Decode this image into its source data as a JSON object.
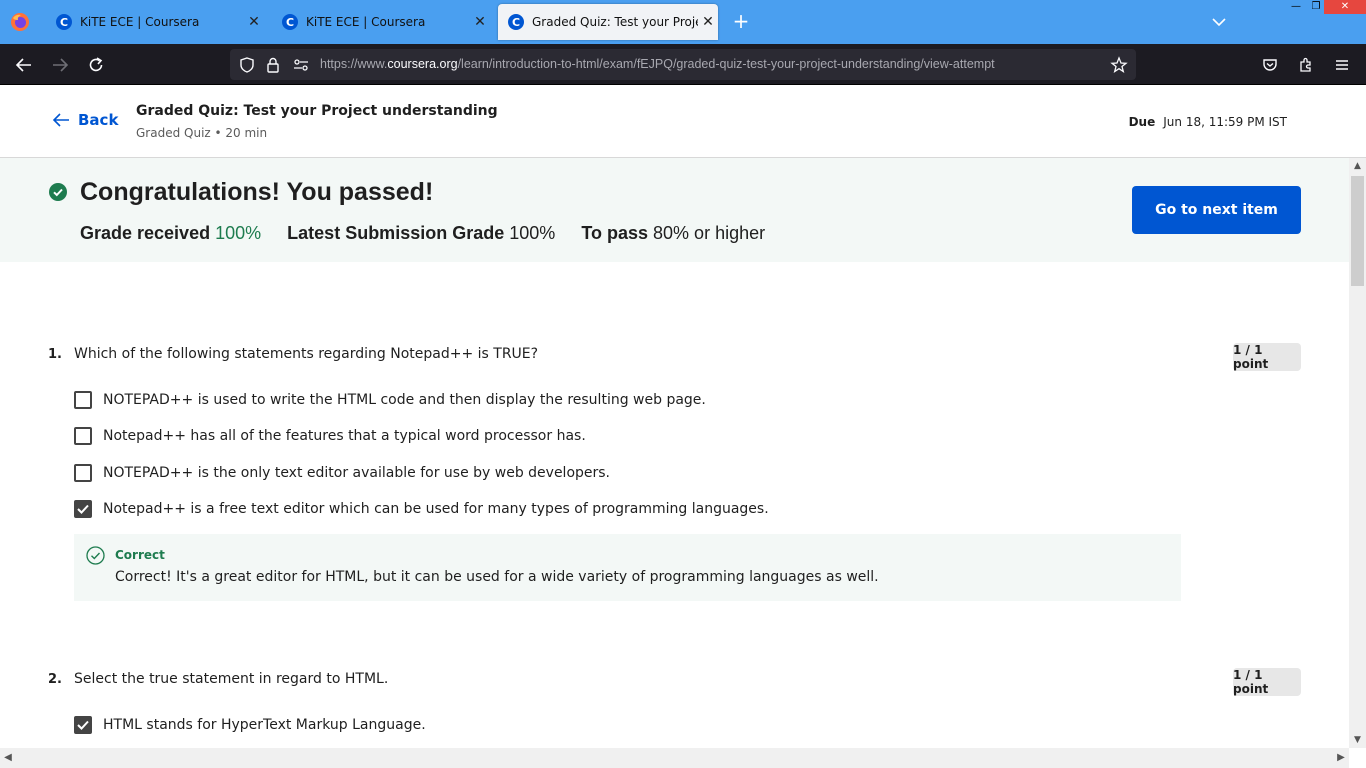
{
  "browser": {
    "tabs": [
      {
        "label": "KiTE ECE | Coursera",
        "favicon": "coursera-c-icon",
        "active": false
      },
      {
        "label": "KiTE ECE | Coursera",
        "favicon": "coursera-c-icon",
        "active": false
      },
      {
        "label": "Graded Quiz: Test your Project understanding",
        "favicon": "coursera-c-icon",
        "active": true
      }
    ],
    "favicon_glyph": "C",
    "url_prefix": "https://www.",
    "url_domain": "coursera.org",
    "url_path": "/learn/introduction-to-html/exam/fEJPQ/graded-quiz-test-your-project-understanding/view-attempt"
  },
  "header": {
    "back_label": "Back",
    "title": "Graded Quiz: Test your Project understanding",
    "subtitle": "Graded Quiz • 20 min",
    "due_label": "Due",
    "due_value": "Jun 18, 11:59 PM IST"
  },
  "result": {
    "headline": "Congratulations! You passed!",
    "grade_label": "Grade received",
    "grade_value": "100%",
    "latest_label": "Latest Submission Grade",
    "latest_value": "100%",
    "pass_label": "To pass",
    "pass_value": "80% or higher",
    "next_button": "Go to next item"
  },
  "questions": [
    {
      "number": "1.",
      "text": "Which of the following statements regarding Notepad++ is TRUE?",
      "points": "1 / 1 point",
      "options": [
        {
          "text": "NOTEPAD++ is used to write the HTML code and then display the resulting web page.",
          "checked": false
        },
        {
          "text": "Notepad++ has all of the features that a typical word processor has.",
          "checked": false
        },
        {
          "text": "NOTEPAD++ is the only text editor available for use by web developers.",
          "checked": false
        },
        {
          "text": "Notepad++ is a free text editor which can be used for many types of programming languages.",
          "checked": true
        }
      ],
      "feedback": {
        "title": "Correct",
        "text": "Correct!  It's a great editor for HTML, but it can be used for a wide variety of programming languages as well."
      }
    },
    {
      "number": "2.",
      "text": "Select the true statement in regard to HTML.",
      "points": "1 / 1 point",
      "options": [
        {
          "text": "HTML stands for HyperText Markup Language.",
          "checked": true
        }
      ]
    }
  ],
  "colors": {
    "accent": "#0056d2",
    "success": "#1e7c4f",
    "banner_bg": "#f3f8f6",
    "tabbar": "#4a9ff0",
    "navbar": "#1c1b22"
  }
}
